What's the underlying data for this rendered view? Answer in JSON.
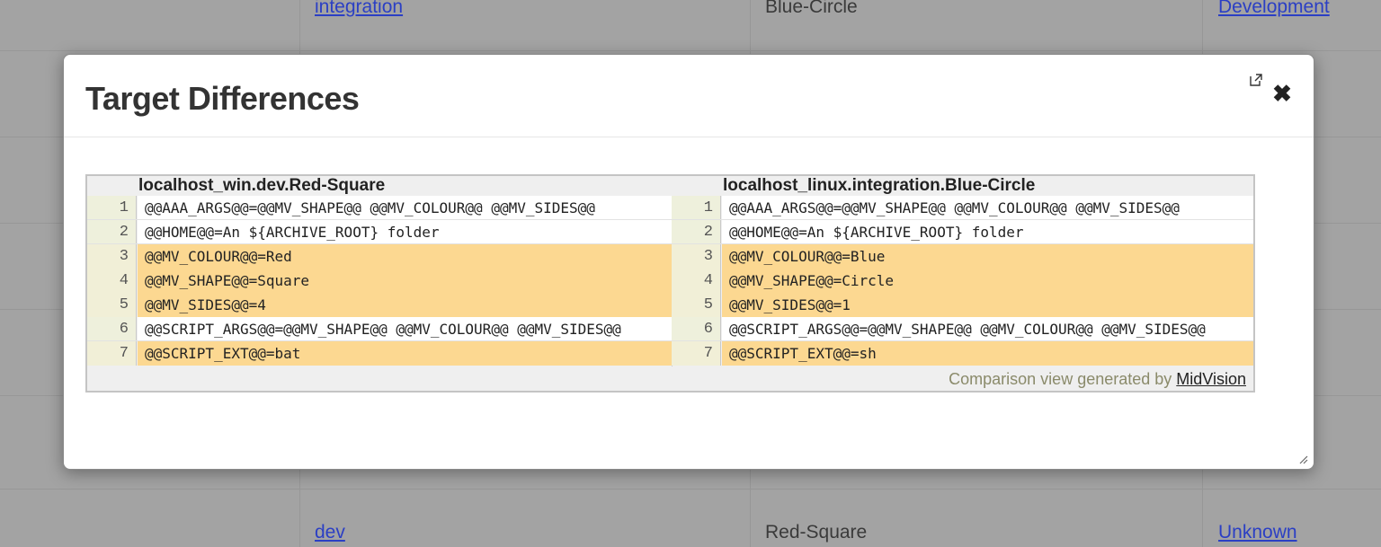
{
  "background_table": {
    "top_row": {
      "environment_link": "integration",
      "target": "Blue-Circle",
      "status_link": "Development"
    },
    "bottom_row": {
      "environment_link": "dev",
      "target": "Red-Square",
      "status_link": "Unknown"
    }
  },
  "modal": {
    "title": "Target Differences",
    "popout_icon": "external-window-icon",
    "close_icon": "close-icon",
    "close_glyph": "✖",
    "resize_icon": "resize-grip-icon"
  },
  "diff": {
    "left_header": "localhost_win.dev.Red-Square",
    "right_header": "localhost_linux.integration.Blue-Circle",
    "left_lines": [
      {
        "num": "1",
        "text": "@@AAA_ARGS@@=@@MV_SHAPE@@ @@MV_COLOUR@@ @@MV_SIDES@@",
        "changed": false
      },
      {
        "num": "2",
        "text": "@@HOME@@=An ${ARCHIVE_ROOT} folder",
        "changed": false
      },
      {
        "num": "3",
        "text": "@@MV_COLOUR@@=Red",
        "changed": true
      },
      {
        "num": "4",
        "text": "@@MV_SHAPE@@=Square",
        "changed": true
      },
      {
        "num": "5",
        "text": "@@MV_SIDES@@=4",
        "changed": true
      },
      {
        "num": "6",
        "text": "@@SCRIPT_ARGS@@=@@MV_SHAPE@@ @@MV_COLOUR@@ @@MV_SIDES@@",
        "changed": false
      },
      {
        "num": "7",
        "text": "@@SCRIPT_EXT@@=bat",
        "changed": true
      }
    ],
    "right_lines": [
      {
        "num": "1",
        "text": "@@AAA_ARGS@@=@@MV_SHAPE@@ @@MV_COLOUR@@ @@MV_SIDES@@",
        "changed": false
      },
      {
        "num": "2",
        "text": "@@HOME@@=An ${ARCHIVE_ROOT} folder",
        "changed": false
      },
      {
        "num": "3",
        "text": "@@MV_COLOUR@@=Blue",
        "changed": true
      },
      {
        "num": "4",
        "text": "@@MV_SHAPE@@=Circle",
        "changed": true
      },
      {
        "num": "5",
        "text": "@@MV_SIDES@@=1",
        "changed": true
      },
      {
        "num": "6",
        "text": "@@SCRIPT_ARGS@@=@@MV_SHAPE@@ @@MV_COLOUR@@ @@MV_SIDES@@",
        "changed": false
      },
      {
        "num": "7",
        "text": "@@SCRIPT_EXT@@=sh",
        "changed": true
      }
    ],
    "footer_prefix": "Comparison view generated by ",
    "footer_link": "MidVision"
  },
  "colors": {
    "changed_line": "#fcd891",
    "unchanged_line": "#ffffff",
    "overlay": "#a3a3a3",
    "link": "#2b3fc4"
  }
}
